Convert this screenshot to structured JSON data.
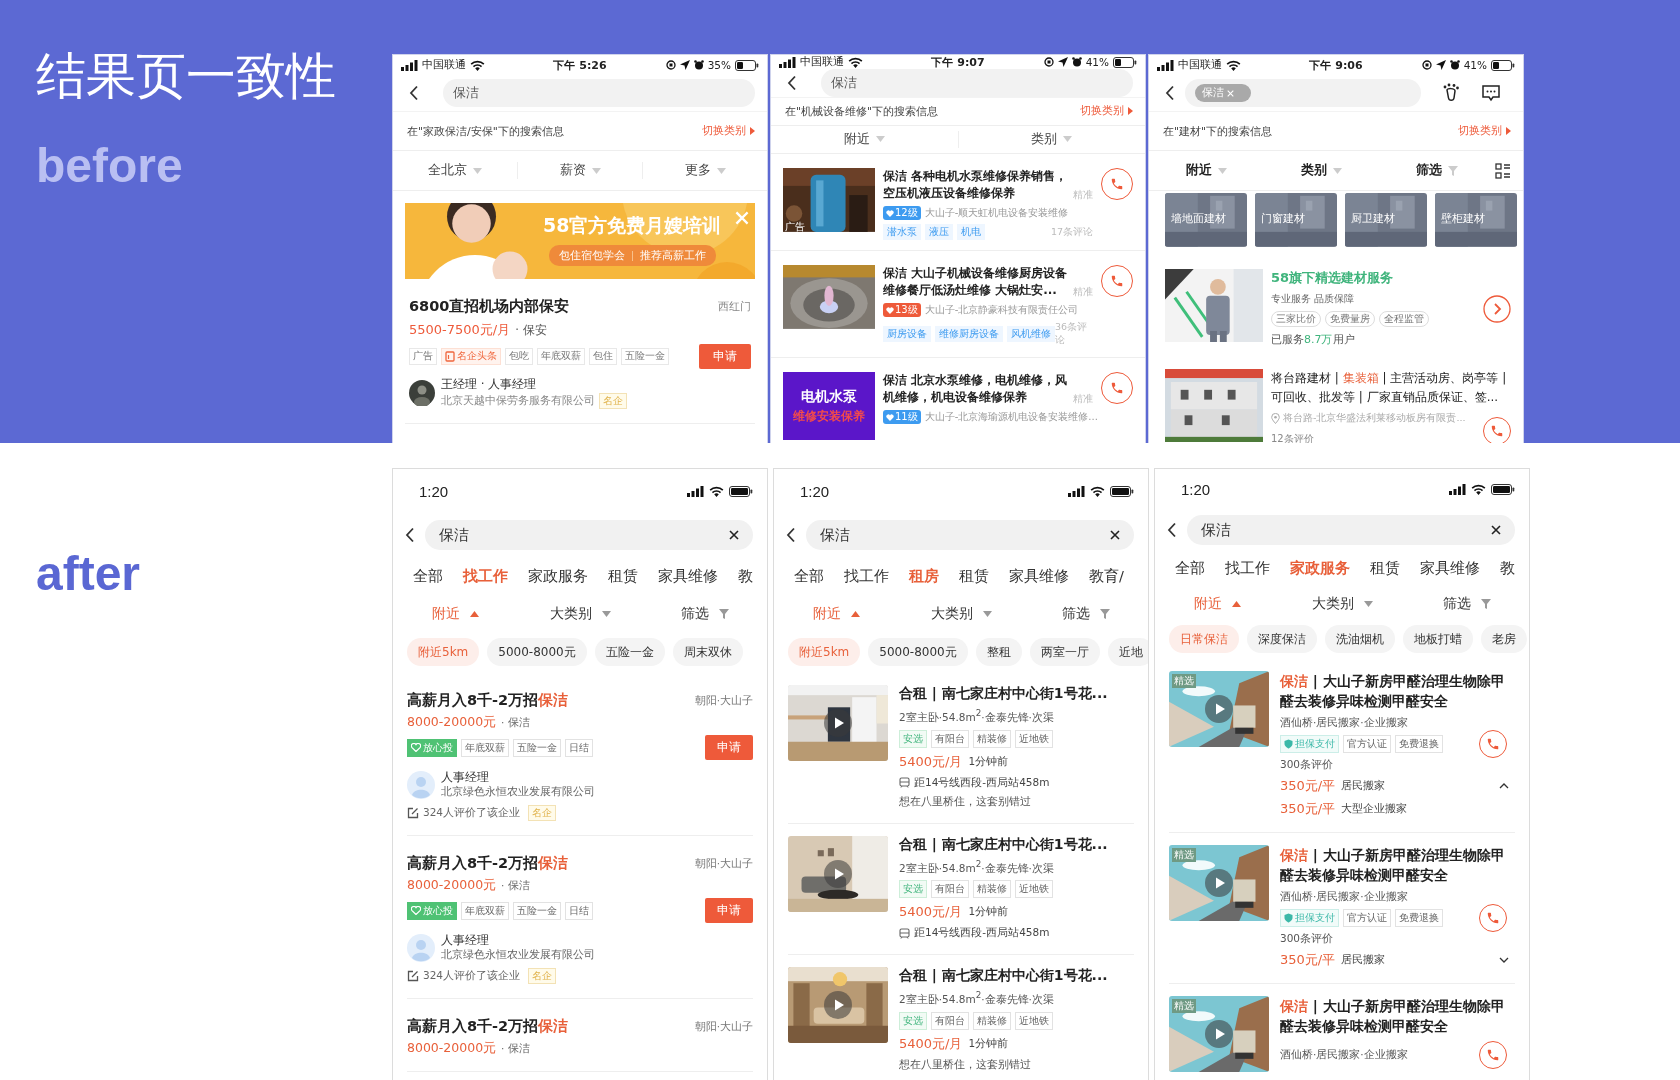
{
  "slide": {
    "title": "结果页一致性",
    "before_label": "before",
    "after_label": "after"
  },
  "before": [
    {
      "kind": "divided",
      "status": {
        "carrier": "中国联通",
        "time": "下午 5:26",
        "battery": "35%"
      },
      "search": {
        "value": "保洁"
      },
      "notice": {
        "text": "在\"家政保洁/安保\"下的搜索信息",
        "link": "切换类别"
      },
      "filters": [
        {
          "label": "全北京",
          "kind": "dropdown"
        },
        {
          "label": "薪资",
          "kind": "dropdown"
        },
        {
          "label": "更多",
          "kind": "dropdown"
        }
      ],
      "items": [
        {
          "kind": "banner",
          "headline": "58官方免费月嫂培训",
          "pills": [
            "包住宿包学会",
            "推荐高薪工作"
          ]
        },
        {
          "kind": "job",
          "title": "6800直招机场内部保安",
          "location": "西红门",
          "salary": "5500-7500元/月",
          "category": "· 保安",
          "tags": [
            {
              "label": "广告",
              "kind": "plain"
            },
            {
              "label": "名企头条",
              "kind": "hot"
            },
            {
              "label": "包吃",
              "kind": "plain"
            },
            {
              "label": "年底双薪",
              "kind": "plain"
            },
            {
              "label": "包住",
              "kind": "plain"
            },
            {
              "label": "五险一金",
              "kind": "plain"
            }
          ],
          "button": "申请",
          "contact": "王经理 · 人事经理",
          "company": "北京天越中保劳务服务有限公司",
          "badge": "名企"
        }
      ]
    },
    {
      "kind": "divided",
      "status": {
        "carrier": "中国联通",
        "time": "下午 9:07",
        "battery": "41%"
      },
      "search": {
        "value": "保洁"
      },
      "notice": {
        "text": "在\"机械设备维修\"下的搜索信息",
        "link": "切换类别"
      },
      "filters": [
        {
          "label": "附近",
          "kind": "dropdown"
        },
        {
          "label": "类别",
          "kind": "dropdown"
        }
      ],
      "items": [
        {
          "kind": "service",
          "ad_label": "广告",
          "title": "保洁 各种电机水泵维修保养销售，空压机液压设备维修保养",
          "precise": "精准",
          "level": {
            "text": "12级",
            "color": "#3d9bf0"
          },
          "shop": "大山子-顺天虹机电设备安装维修",
          "tags": [
            "潜水泵",
            "液压",
            "机电"
          ],
          "reviews": "17条评论"
        },
        {
          "kind": "service",
          "title": "保洁 大山子机械设备维修厨房设备维修餐厅低汤灶维修 大锅灶安...",
          "precise": "精准",
          "level": {
            "text": "13级",
            "color": "#ee5a3a"
          },
          "shop": "大山子-北京静豪科技有限责任公司",
          "tags": [
            "厨房设备",
            "维修厨房设备",
            "风机维修"
          ],
          "reviews": "36条评论"
        },
        {
          "kind": "service",
          "thumb_lines": [
            "电机水泵",
            "维修安装保养"
          ],
          "title": "保洁 北京水泵维修，电机维修，风机维修，机电设备维修保养",
          "precise": "精准",
          "level": {
            "text": "11级",
            "color": "#3d9bf0"
          },
          "shop": "大山子-北京海瑜源机电设备安装维修..."
        }
      ]
    },
    {
      "kind": "bold",
      "status": {
        "carrier": "中国联通",
        "time": "下午 9:06",
        "battery": "41%"
      },
      "search": {
        "chip": "保洁"
      },
      "notice": {
        "text": "在\"建材\"下的搜索信息",
        "link": "切换类别"
      },
      "filters": [
        {
          "label": "附近",
          "kind": "dropdown"
        },
        {
          "label": "类别",
          "kind": "dropdown"
        },
        {
          "label": "筛选",
          "kind": "filter"
        }
      ],
      "items": [
        {
          "kind": "tiles",
          "tiles": [
            "墙地面建材",
            "门窗建材",
            "厨卫建材",
            "壁柜建材"
          ]
        },
        {
          "kind": "promo",
          "title": "58旗下精选建材服务",
          "subtitle": "专业服务 品质保障",
          "tags": [
            "三家比价",
            "免费量房",
            "全程监管"
          ],
          "served_parts": [
            {
              "text": "已服务",
              "highlight": false
            },
            {
              "text": "8.7万",
              "highlight": true
            },
            {
              "text": "用户",
              "highlight": false
            }
          ]
        },
        {
          "kind": "listing",
          "title_parts": [
            {
              "text": "将台路建材 | ",
              "highlight": false
            },
            {
              "text": "集装箱",
              "highlight": true
            },
            {
              "text": " | 主营活动房、岗亭等 | 可回收、批发等 | 厂家直销品质保证、签...",
              "highlight": false
            }
          ],
          "address": "将台路-北京华盛法利莱移动板房有限责...",
          "reviews": "12条评价"
        }
      ]
    }
  ],
  "after": [
    {
      "status": {
        "time": "1:20"
      },
      "search": {
        "value": "保洁"
      },
      "tabs": [
        {
          "label": "全部",
          "selected": false
        },
        {
          "label": "找工作",
          "selected": true
        },
        {
          "label": "家政服务",
          "selected": false
        },
        {
          "label": "租赁",
          "selected": false
        },
        {
          "label": "家具维修",
          "selected": false
        },
        {
          "label": "教",
          "selected": false
        }
      ],
      "sorts": [
        {
          "label": "附近",
          "active": true,
          "kind": "dropdown"
        },
        {
          "label": "大类别",
          "active": false,
          "kind": "dropdown"
        },
        {
          "label": "筛选",
          "active": false,
          "kind": "filter"
        }
      ],
      "chips": [
        {
          "label": "附近5km",
          "selected": true
        },
        {
          "label": "5000-8000元",
          "selected": false
        },
        {
          "label": "五险一金",
          "selected": false
        },
        {
          "label": "周末双休",
          "selected": false
        }
      ],
      "items": [
        {
          "kind": "job",
          "title_parts": [
            {
              "text": "高薪月入8千-2万招",
              "highlight": false
            },
            {
              "text": "保洁",
              "highlight": true
            }
          ],
          "location": "朝阳·大山子",
          "salary": "8000-20000元",
          "category": "· 保洁",
          "tags": [
            {
              "label": "放心投",
              "kind": "trust"
            },
            {
              "label": "年底双薪",
              "kind": "plain"
            },
            {
              "label": "五险一金",
              "kind": "plain"
            },
            {
              "label": "日结",
              "kind": "plain"
            }
          ],
          "button": "申请",
          "contact": "人事经理",
          "company": "北京绿色永恒农业发展有限公司",
          "review": "324人评价了该企业",
          "badge": "名企"
        },
        {
          "kind": "job",
          "title_parts": [
            {
              "text": "高薪月入8千-2万招",
              "highlight": false
            },
            {
              "text": "保洁",
              "highlight": true
            }
          ],
          "location": "朝阳·大山子",
          "salary": "8000-20000元",
          "category": "· 保洁",
          "tags": [
            {
              "label": "放心投",
              "kind": "trust"
            },
            {
              "label": "年底双薪",
              "kind": "plain"
            },
            {
              "label": "五险一金",
              "kind": "plain"
            },
            {
              "label": "日结",
              "kind": "plain"
            }
          ],
          "button": "申请",
          "contact": "人事经理",
          "company": "北京绿色永恒农业发展有限公司",
          "review": "324人评价了该企业",
          "badge": "名企"
        },
        {
          "kind": "job",
          "title_parts": [
            {
              "text": "高薪月入8千-2万招",
              "highlight": false
            },
            {
              "text": "保洁",
              "highlight": true
            }
          ],
          "location": "朝阳·大山子",
          "salary": "8000-20000元",
          "category": "· 保洁"
        }
      ]
    },
    {
      "status": {
        "time": "1:20"
      },
      "search": {
        "value": "保洁"
      },
      "tabs": [
        {
          "label": "全部",
          "selected": false
        },
        {
          "label": "找工作",
          "selected": false
        },
        {
          "label": "租房",
          "selected": true
        },
        {
          "label": "租赁",
          "selected": false
        },
        {
          "label": "家具维修",
          "selected": false
        },
        {
          "label": "教育/",
          "selected": false
        }
      ],
      "sorts": [
        {
          "label": "附近",
          "active": true,
          "kind": "dropdown"
        },
        {
          "label": "大类别",
          "active": false,
          "kind": "dropdown"
        },
        {
          "label": "筛选",
          "active": false,
          "kind": "filter"
        }
      ],
      "chips": [
        {
          "label": "附近5km",
          "selected": true
        },
        {
          "label": "5000-8000元",
          "selected": false
        },
        {
          "label": "整租",
          "selected": false
        },
        {
          "label": "两室一厅",
          "selected": false
        },
        {
          "label": "近地",
          "selected": false
        }
      ],
      "items": [
        {
          "kind": "house",
          "title": "合租 | 南七家庄村中心街1号花...",
          "meta": "2室主卧·54.8m$^{2}$·金泰先锋·次渠",
          "tags": [
            {
              "label": "安选",
              "kind": "green"
            },
            {
              "label": "有阳台",
              "kind": "plain"
            },
            {
              "label": "精装修",
              "kind": "plain"
            },
            {
              "label": "近地铁",
              "kind": "plain"
            }
          ],
          "price": "5400元/月",
          "time": "1分钟前",
          "subway": "距14号线西段-西局站458m",
          "note": "想在八里桥住，这套别错过"
        },
        {
          "kind": "house",
          "title": "合租 | 南七家庄村中心街1号花...",
          "meta": "2室主卧·54.8m$^{2}$·金泰先锋·次渠",
          "tags": [
            {
              "label": "安选",
              "kind": "green"
            },
            {
              "label": "有阳台",
              "kind": "plain"
            },
            {
              "label": "精装修",
              "kind": "plain"
            },
            {
              "label": "近地铁",
              "kind": "plain"
            }
          ],
          "price": "5400元/月",
          "time": "1分钟前",
          "subway": "距14号线西段-西局站458m"
        },
        {
          "kind": "house",
          "title": "合租 | 南七家庄村中心街1号花...",
          "meta": "2室主卧·54.8m$^{2}$·金泰先锋·次渠",
          "tags": [
            {
              "label": "安选",
              "kind": "green"
            },
            {
              "label": "有阳台",
              "kind": "plain"
            },
            {
              "label": "精装修",
              "kind": "plain"
            },
            {
              "label": "近地铁",
              "kind": "plain"
            }
          ],
          "price": "5400元/月",
          "time": "1分钟前",
          "note": "想在八里桥住，这套别错过"
        }
      ]
    },
    {
      "status": {
        "time": "1:20"
      },
      "search": {
        "value": "保洁"
      },
      "tabs": [
        {
          "label": "全部",
          "selected": false
        },
        {
          "label": "找工作",
          "selected": false
        },
        {
          "label": "家政服务",
          "selected": true
        },
        {
          "label": "租赁",
          "selected": false
        },
        {
          "label": "家具维修",
          "selected": false
        },
        {
          "label": "教",
          "selected": false
        }
      ],
      "sorts": [
        {
          "label": "附近",
          "active": true,
          "kind": "dropdown"
        },
        {
          "label": "大类别",
          "active": false,
          "kind": "dropdown"
        },
        {
          "label": "筛选",
          "active": false,
          "kind": "filter"
        }
      ],
      "chips": [
        {
          "label": "日常保洁",
          "selected": true
        },
        {
          "label": "深度保洁",
          "selected": false
        },
        {
          "label": "洗油烟机",
          "selected": false
        },
        {
          "label": "地板打蜡",
          "selected": false
        },
        {
          "label": "老房",
          "selected": false
        }
      ],
      "items": [
        {
          "kind": "home",
          "thumb_badge": "精选",
          "title_parts": [
            {
              "text": "保洁",
              "highlight": true
            },
            {
              "text": " | 大山子新房甲醛治理生物除甲醛去装修异味检测甲醛安全",
              "highlight": false
            }
          ],
          "meta": "酒仙桥·居民搬家·企业搬家",
          "tags": [
            {
              "label": "担保支付",
              "kind": "guarantee"
            },
            {
              "label": "官方认证",
              "kind": "plain"
            },
            {
              "label": "免费退换",
              "kind": "plain"
            }
          ],
          "reviews": "300条评价",
          "expanded": true,
          "prices": [
            {
              "price": "350元/平",
              "name": "居民搬家"
            },
            {
              "price": "350元/平",
              "name": "大型企业搬家"
            }
          ]
        },
        {
          "kind": "home",
          "thumb_badge": "精选",
          "title_parts": [
            {
              "text": "保洁",
              "highlight": true
            },
            {
              "text": " | 大山子新房甲醛治理生物除甲醛去装修异味检测甲醛安全",
              "highlight": false
            }
          ],
          "meta": "酒仙桥·居民搬家·企业搬家",
          "tags": [
            {
              "label": "担保支付",
              "kind": "guarantee"
            },
            {
              "label": "官方认证",
              "kind": "plain"
            },
            {
              "label": "免费退换",
              "kind": "plain"
            }
          ],
          "reviews": "300条评价",
          "expanded": false,
          "prices": [
            {
              "price": "350元/平",
              "name": "居民搬家"
            }
          ]
        },
        {
          "kind": "home",
          "thumb_badge": "精选",
          "title_parts": [
            {
              "text": "保洁",
              "highlight": true
            },
            {
              "text": " | 大山子新房甲醛治理生物除甲醛去装修异味检测甲醛安全",
              "highlight": false
            }
          ],
          "meta": "酒仙桥·居民搬家·企业搬家"
        }
      ]
    }
  ]
}
